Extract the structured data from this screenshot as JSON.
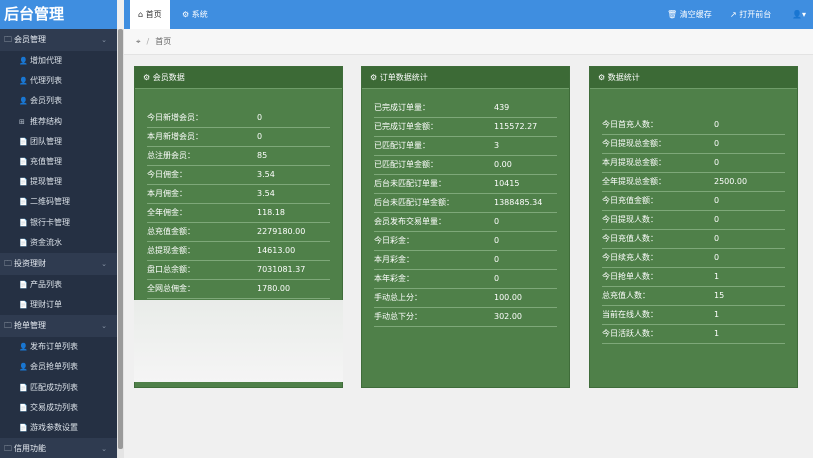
{
  "app": {
    "title": "后台管理"
  },
  "sidebar": {
    "groups": [
      {
        "label": "会员管理",
        "items": [
          "增加代理",
          "代理列表",
          "会员列表",
          "推荐结构",
          "团队管理",
          "充值管理",
          "提现管理",
          "二维码管理",
          "银行卡管理",
          "资金流水"
        ]
      },
      {
        "label": "投资理财",
        "items": [
          "产品列表",
          "理财订单"
        ]
      },
      {
        "label": "抢单管理",
        "items": [
          "发布订单列表",
          "会员抢单列表",
          "匹配成功列表",
          "交易成功列表",
          "游戏参数设置"
        ]
      },
      {
        "label": "信用功能",
        "items": []
      }
    ]
  },
  "topbar": {
    "tabs": [
      {
        "label": "首页",
        "icon": "home-icon"
      },
      {
        "label": "系统",
        "icon": "gear-icon"
      }
    ],
    "clear_cache": "清空缓存",
    "open_frontend": "打开前台"
  },
  "breadcrumb": {
    "home": "首页"
  },
  "panels": {
    "member": {
      "title": "会员数据",
      "rows": [
        {
          "label": "今日新增会员：",
          "value": "0"
        },
        {
          "label": "本月新增会员：",
          "value": "0"
        },
        {
          "label": "总注册会员：",
          "value": "85"
        },
        {
          "label": "今日佣金：",
          "value": "3.54"
        },
        {
          "label": "本月佣金：",
          "value": "3.54"
        },
        {
          "label": "全年佣金：",
          "value": "118.18"
        },
        {
          "label": "总充值金额：",
          "value": "2279180.00"
        },
        {
          "label": "总提现金额：",
          "value": "14613.00"
        },
        {
          "label": "盘口总余额：",
          "value": "7031081.37"
        },
        {
          "label": "全网总佣金：",
          "value": "1780.00"
        }
      ]
    },
    "orders": {
      "title": "订单数据统计",
      "rows": [
        {
          "label": "已完成订单量：",
          "value": "439"
        },
        {
          "label": "已完成订单金额：",
          "value": "115572.27"
        },
        {
          "label": "已匹配订单量：",
          "value": "3"
        },
        {
          "label": "已匹配订单金额：",
          "value": "0.00"
        },
        {
          "label": "后台未匹配订单量：",
          "value": "10415"
        },
        {
          "label": "后台未匹配订单金额：",
          "value": "1388485.34"
        },
        {
          "label": "会员发布交易单量：",
          "value": "0"
        },
        {
          "label": "今日彩金：",
          "value": "0"
        },
        {
          "label": "本月彩金：",
          "value": "0"
        },
        {
          "label": "本年彩金：",
          "value": "0"
        },
        {
          "label": "手动总上分：",
          "value": "100.00"
        },
        {
          "label": "手动总下分：",
          "value": "302.00"
        }
      ]
    },
    "stats": {
      "title": "数据统计",
      "rows": [
        {
          "label": "今日首充人数：",
          "value": "0"
        },
        {
          "label": "今日提现总金额：",
          "value": "0"
        },
        {
          "label": "本月提现总金额：",
          "value": "0"
        },
        {
          "label": "全年提现总金额：",
          "value": "2500.00"
        },
        {
          "label": "今日充值金额：",
          "value": "0"
        },
        {
          "label": "今日提现人数：",
          "value": "0"
        },
        {
          "label": "今日充值人数：",
          "value": "0"
        },
        {
          "label": "今日续充人数：",
          "value": "0"
        },
        {
          "label": "今日抢单人数：",
          "value": "1"
        },
        {
          "label": "总充值人数：",
          "value": "15"
        },
        {
          "label": "当前在线人数：",
          "value": "1"
        },
        {
          "label": "今日活跃人数：",
          "value": "1"
        }
      ]
    }
  }
}
